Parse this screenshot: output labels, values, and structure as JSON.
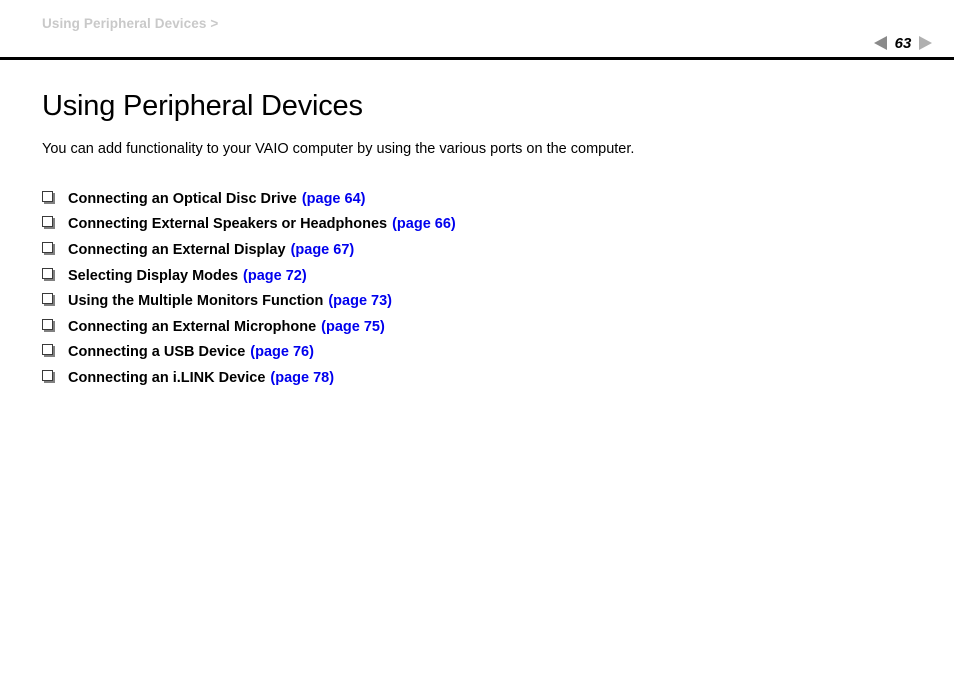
{
  "header": {
    "breadcrumb": "Using Peripheral Devices >",
    "pager": {
      "prev_icon": "triangle-left-icon",
      "next_icon": "triangle-right-icon",
      "page_number": "63"
    }
  },
  "main": {
    "title": "Using Peripheral Devices",
    "intro": "You can add functionality to your VAIO computer by using the various ports on the computer.",
    "toc": [
      {
        "bullet": "square-bullet-icon",
        "label": "Connecting an Optical Disc Drive",
        "page_ref": "(page 64)"
      },
      {
        "bullet": "square-bullet-icon",
        "label": "Connecting External Speakers or Headphones",
        "page_ref": "(page 66)"
      },
      {
        "bullet": "square-bullet-icon",
        "label": "Connecting an External Display",
        "page_ref": "(page 67)"
      },
      {
        "bullet": "square-bullet-icon",
        "label": "Selecting Display Modes",
        "page_ref": "(page 72)"
      },
      {
        "bullet": "square-bullet-icon",
        "label": "Using the Multiple Monitors Function",
        "page_ref": "(page 73)"
      },
      {
        "bullet": "square-bullet-icon",
        "label": "Connecting an External Microphone",
        "page_ref": "(page 75)"
      },
      {
        "bullet": "square-bullet-icon",
        "label": "Connecting a USB Device",
        "page_ref": "(page 76)"
      },
      {
        "bullet": "square-bullet-icon",
        "label": "Connecting an i.LINK Device",
        "page_ref": "(page 78)"
      }
    ]
  },
  "colors": {
    "link": "#0000ee",
    "breadcrumb": "#c9c9c9",
    "rule": "#000000",
    "pager_prev": "#8a8a8a",
    "pager_next": "#b0b0b0"
  }
}
